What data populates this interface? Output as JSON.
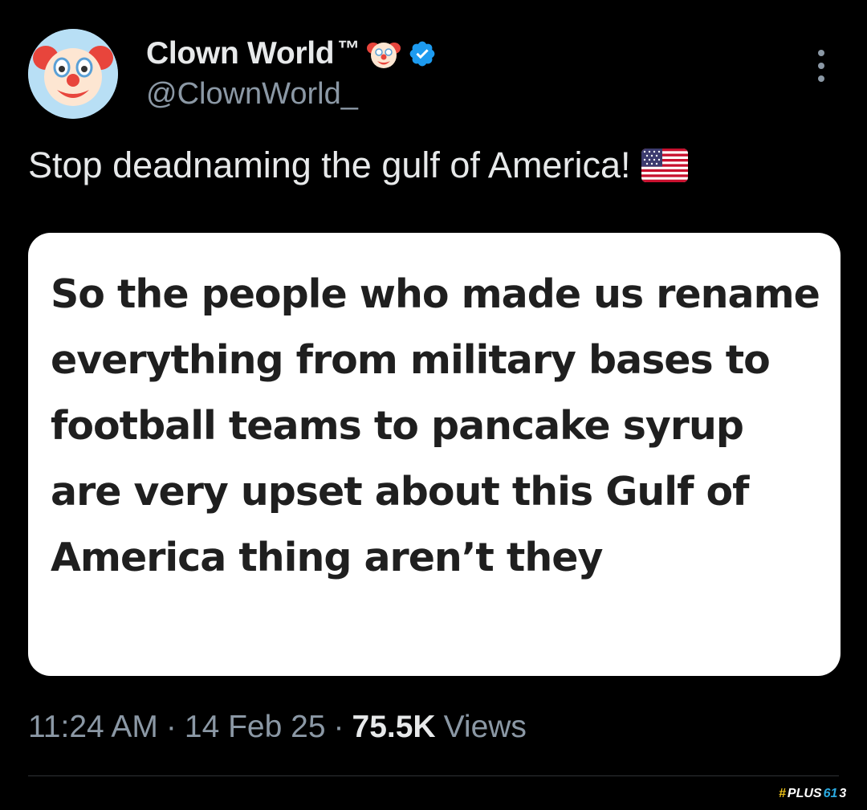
{
  "author": {
    "display_name": "Clown World",
    "trademark": "™",
    "handle": "@ClownWorld_",
    "avatar_icon": "clown-face",
    "badge_icon": "verified-badge",
    "badge_color": "#1d9bf0"
  },
  "tweet": {
    "text": "Stop deadnaming the gulf of America!",
    "emoji": "us-flag"
  },
  "media": {
    "text": "So the people who made us rename everything from military bases to football teams to pancake syrup are very upset about this Gulf of America thing aren’t they"
  },
  "meta": {
    "time": "11:24 AM",
    "separator": "·",
    "date": "14 Feb 25",
    "views_count": "75.5K",
    "views_label": "Views"
  },
  "watermark": {
    "hash": "#",
    "name": "PLUS",
    "number": "61",
    "num_suffix": "3"
  },
  "colors": {
    "background": "#000000",
    "primary_text": "#e7e9ea",
    "secondary_text": "#8b98a5"
  }
}
